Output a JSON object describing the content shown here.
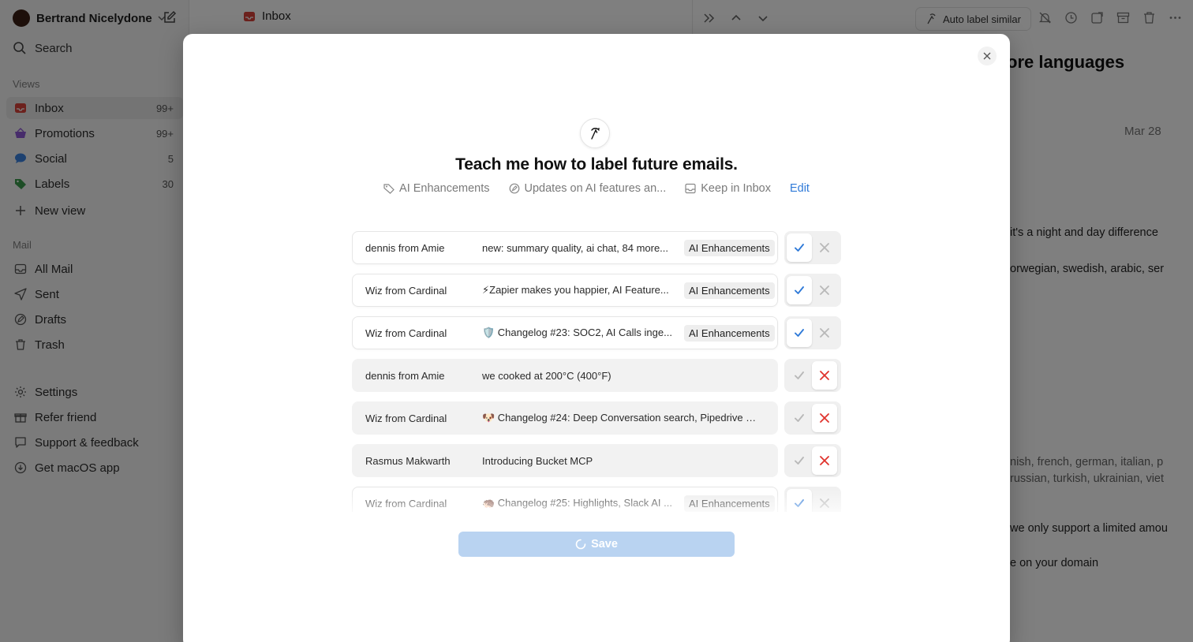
{
  "sidebar": {
    "account_name": "Bertrand Nicelydone",
    "search_label": "Search",
    "views_label": "Views",
    "views": [
      {
        "label": "Inbox",
        "count": "99+"
      },
      {
        "label": "Promotions",
        "count": "99+"
      },
      {
        "label": "Social",
        "count": "5"
      },
      {
        "label": "Labels",
        "count": "30"
      }
    ],
    "new_view_label": "New view",
    "mail_label": "Mail",
    "mail_items": [
      {
        "label": "All Mail"
      },
      {
        "label": "Sent"
      },
      {
        "label": "Drafts"
      },
      {
        "label": "Trash"
      }
    ],
    "footer_items": [
      {
        "label": "Settings"
      },
      {
        "label": "Refer friend"
      },
      {
        "label": "Support & feedback"
      },
      {
        "label": "Get macOS app"
      }
    ]
  },
  "header": {
    "folder_title": "Inbox",
    "auto_label_button": "Auto label similar"
  },
  "reader": {
    "title_fragment": "ore languages",
    "date": "Mar 28",
    "lines": [
      "it's a night and day difference",
      "orwegian, swedish, arabic, ser",
      "nish, french, german, italian, p",
      "russian, turkish, ukrainian, viet",
      "we only support a limited amou",
      "e on your domain"
    ]
  },
  "modal": {
    "title": "Teach me how to label future emails.",
    "rule": {
      "label": "AI Enhancements",
      "description": "Updates on AI features an...",
      "action": "Keep in Inbox",
      "edit_label": "Edit"
    },
    "emails": [
      {
        "sender": "dennis from Amie",
        "subject": "new: summary quality, ai chat, 84 more...",
        "label": "AI Enhancements",
        "decision": "accept"
      },
      {
        "sender": "Wiz from Cardinal",
        "subject": "⚡Zapier makes you happier, AI Feature...",
        "label": "AI Enhancements",
        "decision": "accept"
      },
      {
        "sender": "Wiz from Cardinal",
        "subject": "🛡️ Changelog #23: SOC2, AI Calls inge...",
        "label": "AI Enhancements",
        "decision": "accept"
      },
      {
        "sender": "dennis from Amie",
        "subject": "we cooked at 200°C (400°F)",
        "label": "",
        "decision": "reject"
      },
      {
        "sender": "Wiz from Cardinal",
        "subject": "🐶 Changelog #24: Deep Conversation search, Pipedrive In...",
        "label": "",
        "decision": "reject"
      },
      {
        "sender": "Rasmus Makwarth",
        "subject": "Introducing Bucket MCP",
        "label": "",
        "decision": "reject"
      },
      {
        "sender": "Wiz from Cardinal",
        "subject": "🦔 Changelog #25: Highlights, Slack AI ...",
        "label": "AI Enhancements",
        "decision": "accept"
      }
    ],
    "save_label": "Save"
  },
  "colors": {
    "accent_blue": "#2f7ad8",
    "reject_red": "#e0332c",
    "save_disabled": "#b9d3f1"
  }
}
